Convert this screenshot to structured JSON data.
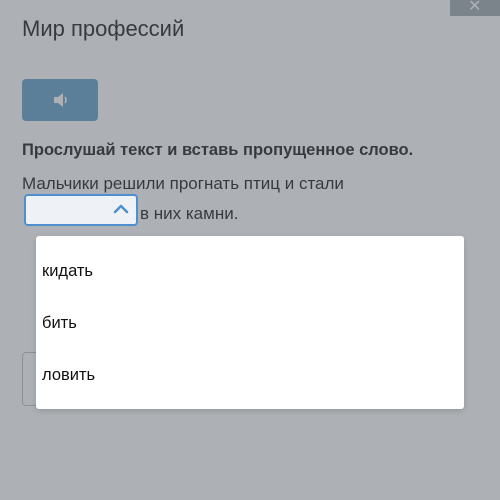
{
  "title": "Мир профессий",
  "instruction": "Прослушай текст и вставь пропущенное слово.",
  "sentence": {
    "part1": "Мальчики решили прогнать птиц и стали",
    "part2": "в них камни."
  },
  "audio_button": {
    "icon": "speaker-icon"
  },
  "dropdown": {
    "selected": "",
    "options": [
      "кидать",
      "бить",
      "ловить"
    ]
  },
  "colors": {
    "audio_button": "#5b9bc6",
    "select_border": "#4f8fd0",
    "overlay": "#5c646c"
  }
}
